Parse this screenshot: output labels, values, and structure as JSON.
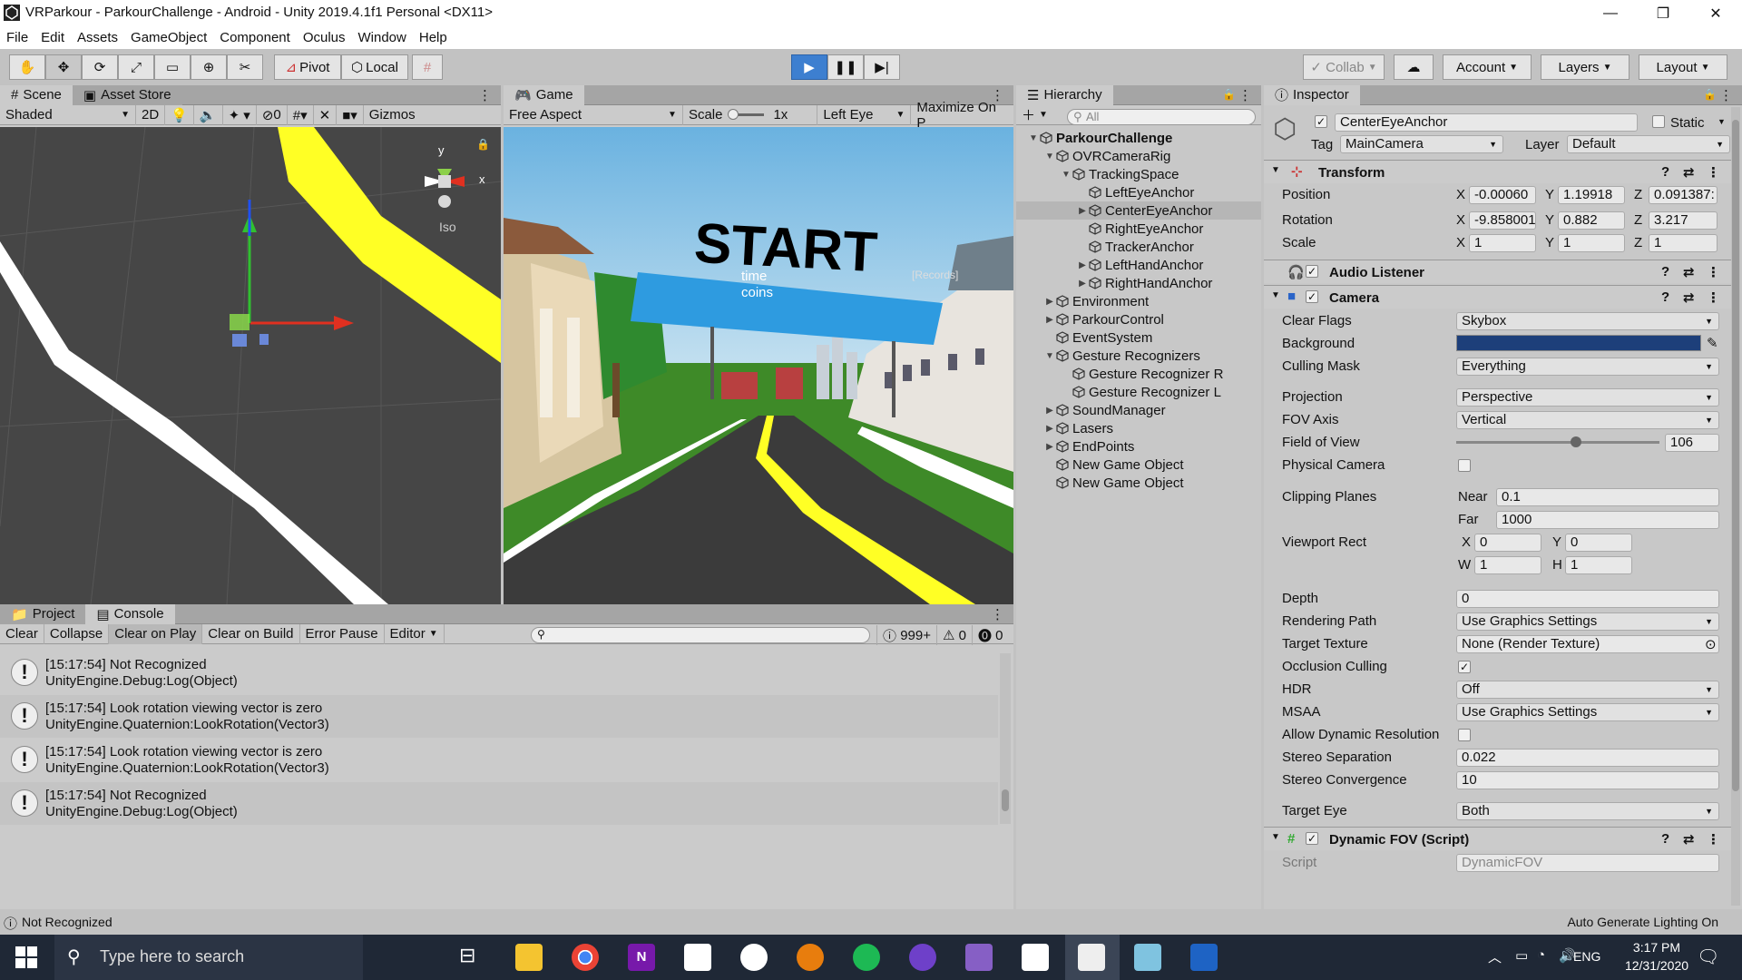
{
  "window": {
    "title": "VRParkour - ParkourChallenge - Android - Unity 2019.4.1f1 Personal <DX11>",
    "minimize": "—",
    "restore": "❐",
    "close": "✕"
  },
  "menu": [
    "File",
    "Edit",
    "Assets",
    "GameObject",
    "Component",
    "Oculus",
    "Window",
    "Help"
  ],
  "toolbar": {
    "pivot": "Pivot",
    "local": "Local",
    "collab": "Collab",
    "account": "Account",
    "layers": "Layers",
    "layout": "Layout"
  },
  "scene": {
    "tab_scene": "Scene",
    "tab_asset_store": "Asset Store",
    "shading": "Shaded",
    "mode_2d": "2D",
    "hidden_count": "0",
    "gizmos": "Gizmos",
    "axis_y": "y",
    "axis_x": "x",
    "projection": "Iso"
  },
  "game": {
    "tab_game": "Game",
    "aspect": "Free Aspect",
    "scale_label": "Scale",
    "scale_value": "1x",
    "eye": "Left Eye",
    "maximize": "Maximize On P",
    "banner": "START",
    "hud_time": "time",
    "hud_coins": "coins",
    "hud_records": "[Records]"
  },
  "hierarchy": {
    "tab": "Hierarchy",
    "search_placeholder": "All",
    "items": [
      {
        "label": "ParkourChallenge",
        "depth": 0,
        "fold": "▼",
        "bold": true
      },
      {
        "label": "OVRCameraRig",
        "depth": 1,
        "fold": "▼"
      },
      {
        "label": "TrackingSpace",
        "depth": 2,
        "fold": "▼"
      },
      {
        "label": "LeftEyeAnchor",
        "depth": 3,
        "fold": ""
      },
      {
        "label": "CenterEyeAnchor",
        "depth": 3,
        "fold": "▶",
        "selected": true
      },
      {
        "label": "RightEyeAnchor",
        "depth": 3,
        "fold": ""
      },
      {
        "label": "TrackerAnchor",
        "depth": 3,
        "fold": ""
      },
      {
        "label": "LeftHandAnchor",
        "depth": 3,
        "fold": "▶"
      },
      {
        "label": "RightHandAnchor",
        "depth": 3,
        "fold": "▶"
      },
      {
        "label": "Environment",
        "depth": 1,
        "fold": "▶"
      },
      {
        "label": "ParkourControl",
        "depth": 1,
        "fold": "▶"
      },
      {
        "label": "EventSystem",
        "depth": 1,
        "fold": ""
      },
      {
        "label": "Gesture Recognizers",
        "depth": 1,
        "fold": "▼"
      },
      {
        "label": "Gesture Recognizer R",
        "depth": 2,
        "fold": ""
      },
      {
        "label": "Gesture Recognizer L",
        "depth": 2,
        "fold": ""
      },
      {
        "label": "SoundManager",
        "depth": 1,
        "fold": "▶"
      },
      {
        "label": "Lasers",
        "depth": 1,
        "fold": "▶"
      },
      {
        "label": "EndPoints",
        "depth": 1,
        "fold": "▶"
      },
      {
        "label": "New Game Object",
        "depth": 1,
        "fold": ""
      },
      {
        "label": "New Game Object",
        "depth": 1,
        "fold": ""
      }
    ]
  },
  "inspector": {
    "tab": "Inspector",
    "object_name": "CenterEyeAnchor",
    "static_label": "Static",
    "tag_label": "Tag",
    "tag_value": "MainCamera",
    "layer_label": "Layer",
    "layer_value": "Default",
    "transform": {
      "title": "Transform",
      "position_label": "Position",
      "rotation_label": "Rotation",
      "scale_label": "Scale",
      "pos_x": "-0.00060",
      "pos_y": "1.19918",
      "pos_z": "0.091387:",
      "rot_x": "-9.858001",
      "rot_y": "0.882",
      "rot_z": "3.217",
      "scl_x": "1",
      "scl_y": "1",
      "scl_z": "1",
      "x": "X",
      "y": "Y",
      "z": "Z"
    },
    "audio_listener": "Audio Listener",
    "camera": {
      "title": "Camera",
      "clear_flags_label": "Clear Flags",
      "clear_flags": "Skybox",
      "background_label": "Background",
      "background_color": "#1d3f7a",
      "culling_mask_label": "Culling Mask",
      "culling_mask": "Everything",
      "projection_label": "Projection",
      "projection": "Perspective",
      "fov_axis_label": "FOV Axis",
      "fov_axis": "Vertical",
      "fov_label": "Field of View",
      "fov": "106",
      "fov_slider_fraction": 0.59,
      "physical_label": "Physical Camera",
      "clipping_label": "Clipping Planes",
      "near_label": "Near",
      "near": "0.1",
      "far_label": "Far",
      "far": "1000",
      "viewport_label": "Viewport Rect",
      "vx": "0",
      "vy": "0",
      "vw": "1",
      "vh": "1",
      "x": "X",
      "y": "Y",
      "w": "W",
      "h": "H",
      "depth_label": "Depth",
      "depth": "0",
      "render_path_label": "Rendering Path",
      "render_path": "Use Graphics Settings",
      "target_tex_label": "Target Texture",
      "target_tex": "None (Render Texture)",
      "occlusion_label": "Occlusion Culling",
      "hdr_label": "HDR",
      "hdr": "Off",
      "msaa_label": "MSAA",
      "msaa": "Use Graphics Settings",
      "dyn_res_label": "Allow Dynamic Resolution",
      "stereo_sep_label": "Stereo Separation",
      "stereo_sep": "0.022",
      "stereo_conv_label": "Stereo Convergence",
      "stereo_conv": "10",
      "target_eye_label": "Target Eye",
      "target_eye": "Both"
    },
    "dynamic_fov": {
      "title": "Dynamic FOV (Script)",
      "script_label": "Script",
      "script_value": "DynamicFOV"
    }
  },
  "console": {
    "tab_project": "Project",
    "tab_console": "Console",
    "clear": "Clear",
    "collapse": "Collapse",
    "clear_on_play": "Clear on Play",
    "clear_on_build": "Clear on Build",
    "error_pause": "Error Pause",
    "editor": "Editor",
    "log_count": "999+",
    "warn_count": "0",
    "err_count": "0",
    "entries": [
      {
        "line1": "[15:17:54] Not Recognized",
        "line2": "UnityEngine.Debug:Log(Object)"
      },
      {
        "line1": "[15:17:54] Look rotation viewing vector is zero",
        "line2": "UnityEngine.Quaternion:LookRotation(Vector3)"
      },
      {
        "line1": "[15:17:54] Look rotation viewing vector is zero",
        "line2": "UnityEngine.Quaternion:LookRotation(Vector3)"
      },
      {
        "line1": "[15:17:54] Not Recognized",
        "line2": "UnityEngine.Debug:Log(Object)"
      }
    ]
  },
  "statusbar": {
    "message": "Not Recognized",
    "right": "Auto Generate Lighting On"
  },
  "taskbar": {
    "search_placeholder": "Type here to search",
    "lang": "ENG",
    "time": "3:17 PM",
    "date": "12/31/2020"
  }
}
